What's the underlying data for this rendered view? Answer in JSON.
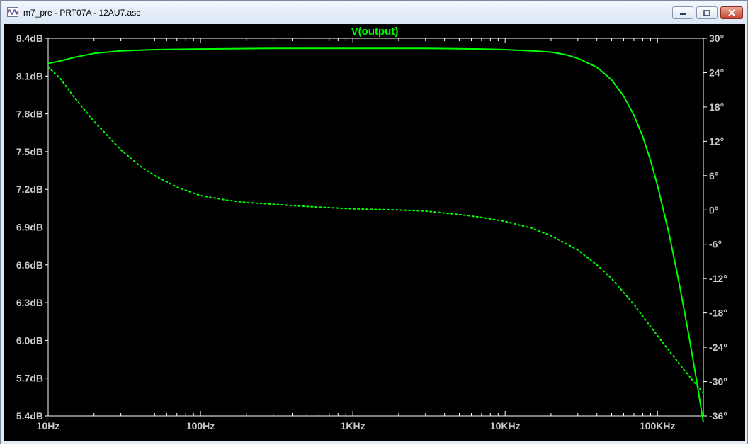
{
  "window": {
    "title": "m7_pre - PRT07A - 12AU7.asc",
    "icon": "waveform-viewer-icon",
    "buttons": [
      "minimize-icon",
      "maximize-icon",
      "close-icon"
    ]
  },
  "colors": {
    "background": "#000000",
    "trace": "#00ff00",
    "axis_text": "#c8c8c8",
    "grid": "#808080"
  },
  "chart_data": {
    "type": "line",
    "title": "V(output)",
    "x_scale": "log",
    "xlim": [
      10,
      200000
    ],
    "x_tick_labels": [
      "10Hz",
      "100Hz",
      "1KHz",
      "10KHz",
      "100KHz"
    ],
    "x_tick_values": [
      10,
      100,
      1000,
      10000,
      100000
    ],
    "ylim_left": [
      5.4,
      8.4
    ],
    "y_tick_labels_left": [
      "8.4dB",
      "8.1dB",
      "7.8dB",
      "7.5dB",
      "7.2dB",
      "6.9dB",
      "6.6dB",
      "6.3dB",
      "6.0dB",
      "5.7dB",
      "5.4dB"
    ],
    "y_tick_values_left": [
      8.4,
      8.1,
      7.8,
      7.5,
      7.2,
      6.9,
      6.6,
      6.3,
      6.0,
      5.7,
      5.4
    ],
    "ylim_right": [
      -36,
      30
    ],
    "y_tick_labels_right": [
      "30°",
      "24°",
      "18°",
      "12°",
      "6°",
      "0°",
      "-6°",
      "-12°",
      "-18°",
      "-24°",
      "-30°",
      "-36°"
    ],
    "y_tick_values_right": [
      30,
      24,
      18,
      12,
      6,
      0,
      -6,
      -12,
      -18,
      -24,
      -30,
      -36
    ],
    "grid": false,
    "series": [
      {
        "style": "solid",
        "axis": "left",
        "x": [
          10,
          12,
          15,
          20,
          30,
          50,
          100,
          300,
          1000,
          3000,
          7000,
          10000,
          15000,
          20000,
          25000,
          30000,
          40000,
          50000,
          60000,
          70000,
          80000,
          90000,
          100000,
          120000,
          140000,
          160000,
          180000,
          200000
        ],
        "values": [
          8.2,
          8.22,
          8.25,
          8.28,
          8.3,
          8.31,
          8.315,
          8.32,
          8.32,
          8.32,
          8.315,
          8.31,
          8.3,
          8.29,
          8.27,
          8.24,
          8.17,
          8.07,
          7.94,
          7.79,
          7.62,
          7.43,
          7.23,
          6.83,
          6.43,
          6.05,
          5.69,
          5.35
        ]
      },
      {
        "style": "dotted",
        "axis": "right",
        "x": [
          10,
          12,
          15,
          20,
          30,
          40,
          50,
          70,
          100,
          150,
          200,
          300,
          500,
          700,
          1000,
          2000,
          3000,
          5000,
          7000,
          10000,
          15000,
          20000,
          30000,
          40000,
          50000,
          70000,
          100000,
          150000,
          200000
        ],
        "values": [
          25,
          23,
          19.5,
          15.5,
          10.5,
          7.7,
          6,
          4,
          2.5,
          1.7,
          1.3,
          1,
          0.6,
          0.4,
          0.2,
          0,
          -0.2,
          -0.8,
          -1.3,
          -2,
          -3.2,
          -4.5,
          -7,
          -9.6,
          -12,
          -16.5,
          -22,
          -28,
          -32
        ]
      }
    ]
  }
}
